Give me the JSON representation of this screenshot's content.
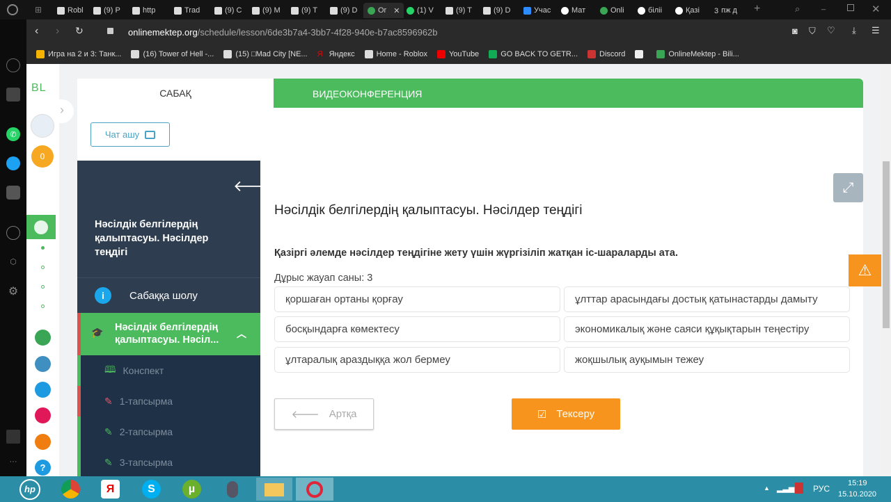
{
  "browser": {
    "tabs": [
      "Robl",
      "(9) P",
      "http",
      "Trad",
      "(9) C",
      "(9) M",
      "(9) T",
      "(9) D",
      "Or",
      "(1) V",
      "(9) T",
      "(9) D",
      "Учас",
      "Мат",
      "Onli",
      "біліі",
      "Қазі",
      "пж д"
    ],
    "tab_badge": "3",
    "url_host": "onlinemektep.org",
    "url_path": "/schedule/lesson/6de3b7a4-3bb7-4f28-940e-b7ac8596962b",
    "bookmarks": [
      "Игра на 2 и 3: Танк...",
      "(16) Tower of Hell -...",
      "(15) □Mad City [NE...",
      "Яндекс",
      "Home - Roblox",
      "YouTube",
      "GO BACK TO GETR...",
      "Discord",
      "",
      "OnlineMektep - Bili..."
    ]
  },
  "app": {
    "logo": "BL",
    "coins": "0",
    "help": "?"
  },
  "tabs": {
    "lesson": "САБАҚ",
    "video": "ВИДЕОКОНФЕРЕНЦИЯ"
  },
  "chat_button": "Чат ашу",
  "nav": {
    "lesson_title": "Нәсілдік белгілердің қалыптасуы. Нәсілдер теңдігі",
    "overview": "Сабаққа шолу",
    "active_topic": "Нәсілдік белгілердің қалыптасуы. Нәсіл...",
    "items": [
      "Конспект",
      "1-тапсырма",
      "2-тапсырма",
      "3-тапсырма"
    ]
  },
  "main": {
    "title": "Нәсілдік белгілердің қалыптасуы. Нәсілдер теңдігі",
    "question": "Қазіргі әлемде нәсілдер теңдігіне жету үшін жүргізіліп жатқан іс-шараларды ата.",
    "answer_count": "Дұрыс жауап саны: 3",
    "options": [
      "қоршаған ортаны қорғау",
      "ұлттар арасындағы достық қатынастарды дамыту",
      "босқындарға көмектесу",
      "экономикалық және саяси құқықтарын теңестіру",
      "ұлтаралық араздыққа жол бермеу",
      "жоқшылық ауқымын тежеу"
    ],
    "back": "Артқа",
    "check": "Тексеру"
  },
  "taskbar": {
    "lang": "РУС",
    "time": "15:19",
    "date": "15.10.2020"
  },
  "colors": {
    "green": "#4cbb5e",
    "orange": "#f7941d",
    "nav": "#2e3e50",
    "taskbar": "#2b8ea6"
  }
}
